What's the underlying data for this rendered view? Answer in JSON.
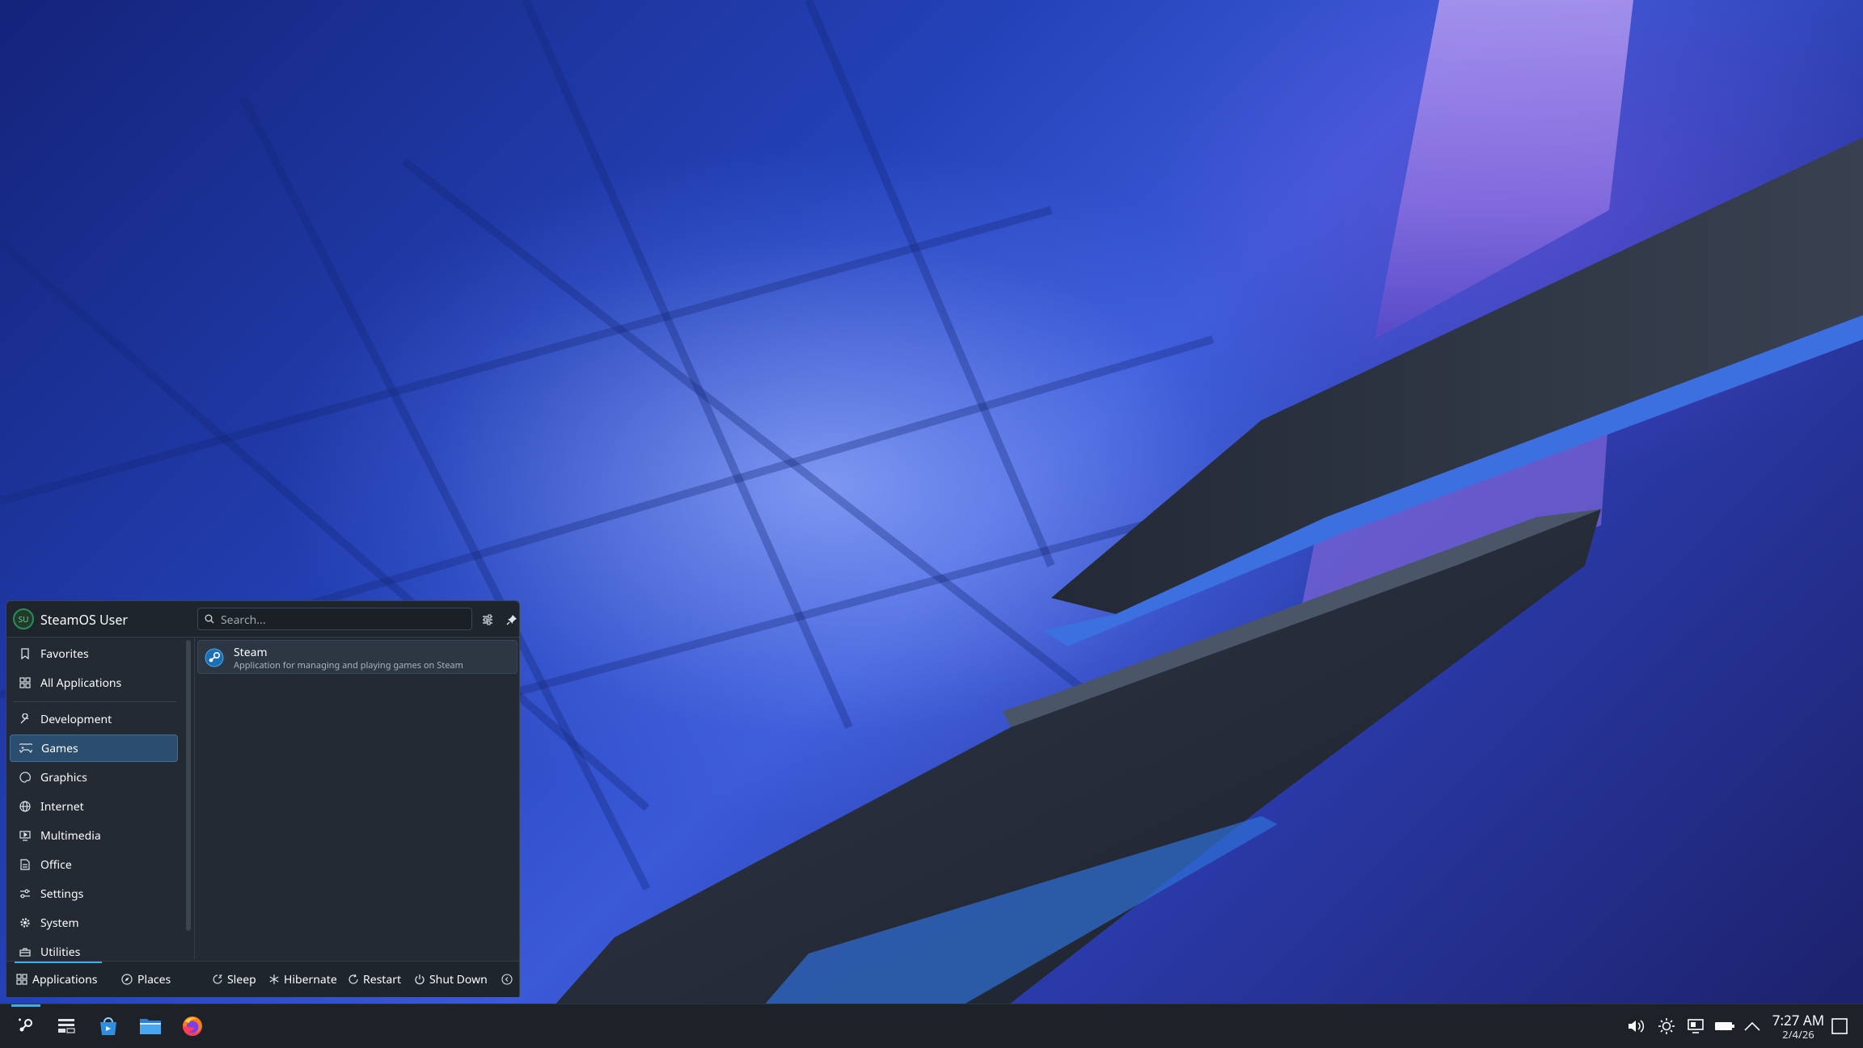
{
  "user": {
    "initials": "SU",
    "name": "SteamOS User"
  },
  "search": {
    "placeholder": "Search..."
  },
  "categories": [
    {
      "label": "Favorites",
      "icon": "bookmark-icon"
    },
    {
      "label": "All Applications",
      "icon": "grid-icon"
    },
    {
      "label": "Development",
      "icon": "wrench-icon"
    },
    {
      "label": "Games",
      "icon": "gamepad-icon",
      "selected": true
    },
    {
      "label": "Graphics",
      "icon": "palette-icon"
    },
    {
      "label": "Internet",
      "icon": "globe-icon"
    },
    {
      "label": "Multimedia",
      "icon": "monitor-play-icon"
    },
    {
      "label": "Office",
      "icon": "document-icon"
    },
    {
      "label": "Settings",
      "icon": "sliders-icon"
    },
    {
      "label": "System",
      "icon": "gear-icon"
    },
    {
      "label": "Utilities",
      "icon": "toolbox-icon"
    }
  ],
  "results": [
    {
      "name": "Steam",
      "description": "Application for managing and playing games on Steam",
      "icon": "steam-icon"
    }
  ],
  "footer": {
    "tabs": [
      {
        "label": "Applications",
        "icon": "grid-icon",
        "active": true
      },
      {
        "label": "Places",
        "icon": "compass-icon"
      }
    ],
    "power": [
      {
        "label": "Sleep",
        "icon": "sleep-icon"
      },
      {
        "label": "Hibernate",
        "icon": "snowflake-icon"
      },
      {
        "label": "Restart",
        "icon": "restart-icon"
      },
      {
        "label": "Shut Down",
        "icon": "power-icon"
      }
    ]
  },
  "taskbar": {
    "launchers": [
      "app-launcher-icon",
      "task-switcher-icon",
      "discover-store-icon",
      "file-manager-icon",
      "firefox-icon"
    ]
  },
  "tray": {
    "icons": [
      "volume-icon",
      "brightness-icon",
      "display-icon",
      "battery-icon",
      "show-hidden-icon"
    ]
  },
  "clock": {
    "time": "7:27 AM",
    "date": "2/4/26"
  },
  "colors": {
    "accent": "#3daee9",
    "selection": "#2b4e6e",
    "panel": "#1d2229",
    "menu": "#232a33"
  }
}
